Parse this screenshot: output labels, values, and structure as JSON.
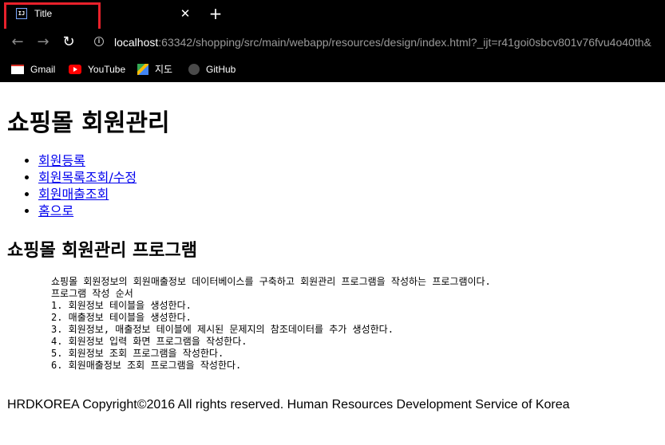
{
  "browser": {
    "tab": {
      "favicon_text": "IJ",
      "title": "Title",
      "close_glyph": "✕"
    },
    "new_tab_glyph": "+",
    "nav": {
      "back_glyph": "←",
      "forward_glyph": "→",
      "reload_glyph": "↻"
    },
    "url": {
      "host": "localhost",
      "rest": ":63342/shopping/src/main/webapp/resources/design/index.html?_ijt=r41goi0sbcv801v76fvu4o40th&"
    },
    "bookmarks": [
      {
        "label": "Gmail",
        "icon": "gmail-icon"
      },
      {
        "label": "YouTube",
        "icon": "youtube-icon"
      },
      {
        "label": "지도",
        "icon": "maps-icon"
      },
      {
        "label": "GitHub",
        "icon": "github-icon"
      }
    ],
    "highlight_color": "#e8212b"
  },
  "page": {
    "title": "쇼핑몰 회원관리",
    "menu": [
      {
        "label": "회원등록"
      },
      {
        "label": "회원목록조회/수정"
      },
      {
        "label": "회원매출조회"
      },
      {
        "label": "홈으로"
      }
    ],
    "section_title": "쇼핑몰 회원관리 프로그램",
    "description": [
      "쇼핑몰 회원정보의 회원매출정보 데이터베이스를 구축하고 회원관리 프로그램을 작성하는 프로그램이다.",
      "프로그램 작성 순서",
      "1. 회원정보 테이블을 생성한다.",
      "2. 매출정보 테이블을 생성한다.",
      "3. 회원정보, 매출정보 테이블에 제시된 문제지의 참조데이터를 추가 생성한다.",
      "4. 회원정보 입력 화면 프로그램을 작성한다.",
      "5. 회원정보 조회 프로그램을 작성한다.",
      "6. 회원매출정보 조회 프로그램을 작성한다."
    ],
    "footer": "HRDKOREA Copyright©2016 All rights reserved. Human Resources Development Service of Korea",
    "link_color": "#0000ee"
  }
}
